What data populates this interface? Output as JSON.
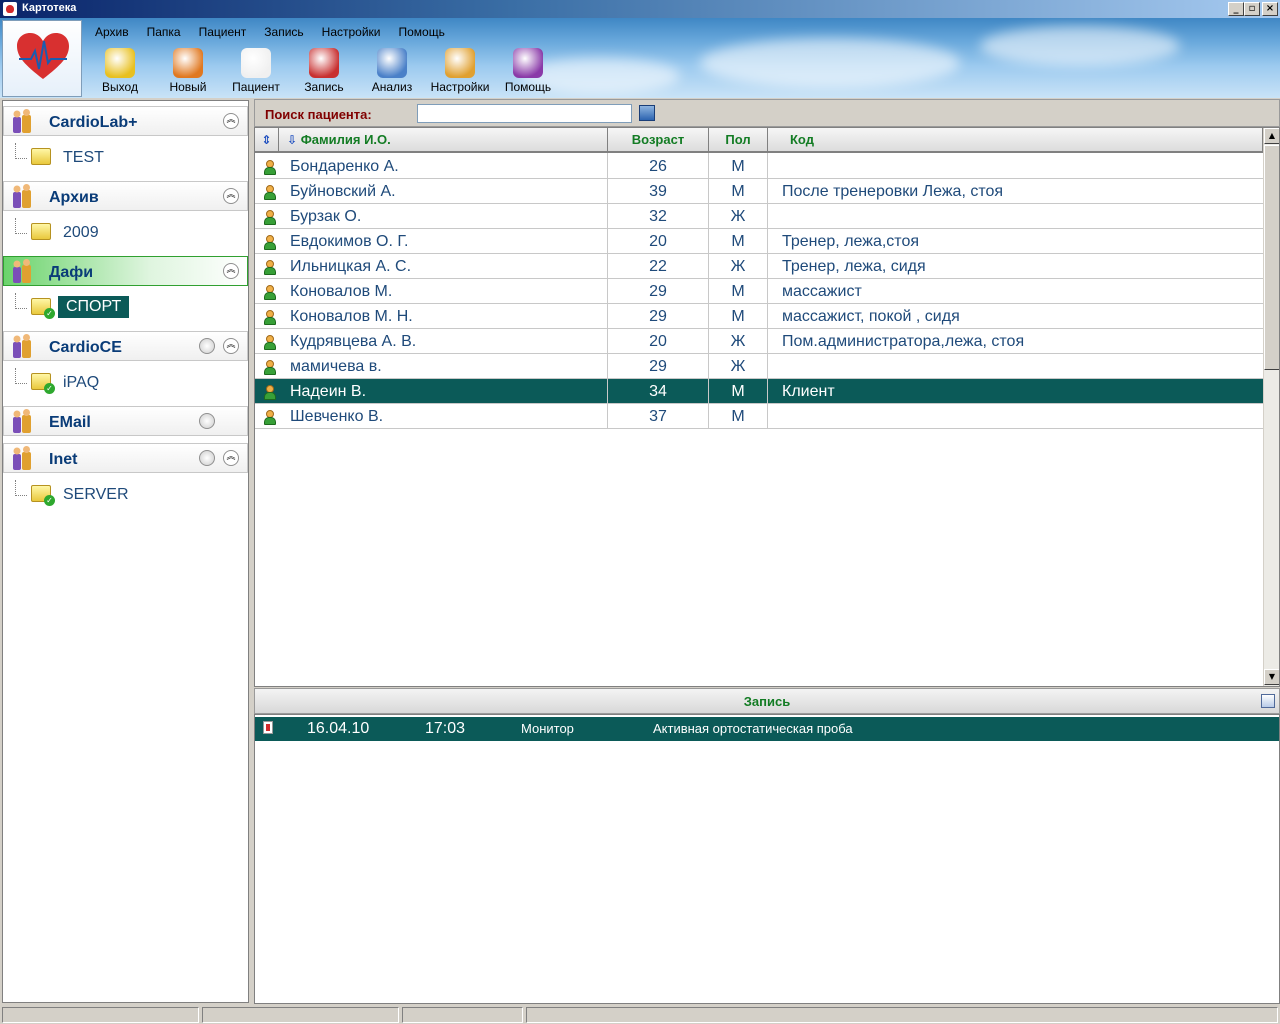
{
  "window": {
    "title": "Картотека"
  },
  "menu": [
    "Архив",
    "Папка",
    "Пациент",
    "Запись",
    "Настройки",
    "Помощь"
  ],
  "toolbar": [
    {
      "label": "Выход",
      "icon": "footprints-icon",
      "color": "#e8c020"
    },
    {
      "label": "Новый",
      "icon": "add-user-icon",
      "color": "#e07820"
    },
    {
      "label": "Пациент",
      "icon": "patient-card-icon",
      "color": "#f0f0f0"
    },
    {
      "label": "Запись",
      "icon": "record-icon",
      "color": "#c83030"
    },
    {
      "label": "Анализ",
      "icon": "analysis-computer-icon",
      "color": "#4a80c8"
    },
    {
      "label": "Настройки",
      "icon": "settings-checklist-icon",
      "color": "#e0a030"
    },
    {
      "label": "Помощь",
      "icon": "help-book-icon",
      "color": "#8a3aa8"
    }
  ],
  "sidebar": {
    "groups": [
      {
        "label": "CardioLab+",
        "icon": "people-group-icon",
        "sub": "TEST",
        "active": false,
        "has_status": false,
        "has_collapse": true
      },
      {
        "label": "Архив",
        "icon": "people-group-icon",
        "sub": "2009",
        "active": false,
        "has_status": false,
        "has_collapse": true
      },
      {
        "label": "Дафи",
        "icon": "people-group-icon",
        "sub": "СПОРТ",
        "active": true,
        "has_status": false,
        "has_collapse": true
      },
      {
        "label": "CardioCE",
        "icon": "pda-device-icon",
        "sub": "iPAQ",
        "active": false,
        "has_status": true,
        "has_collapse": true
      },
      {
        "label": "EMail",
        "icon": "email-folder-icon",
        "sub": "",
        "active": false,
        "has_status": true,
        "has_collapse": false
      },
      {
        "label": "Inet",
        "icon": "network-icon",
        "sub": "SERVER",
        "active": false,
        "has_status": true,
        "has_collapse": true
      }
    ]
  },
  "search": {
    "label": "Поиск пациента:",
    "value": ""
  },
  "patients": {
    "columns": {
      "name": "Фамилия И.О.",
      "age": "Возраст",
      "sex": "Пол",
      "code": "Код"
    },
    "rows": [
      {
        "name": "Бондаренко  А.",
        "age": "26",
        "sex": "М",
        "code": "",
        "selected": false
      },
      {
        "name": "Буйновский  А.",
        "age": "39",
        "sex": "М",
        "code": "После тренеровки Лежа, стоя",
        "selected": false
      },
      {
        "name": "Бурзак  О.",
        "age": "32",
        "sex": "Ж",
        "code": "",
        "selected": false
      },
      {
        "name": "Евдокимов  О. Г.",
        "age": "20",
        "sex": "М",
        "code": "Тренер, лежа,стоя",
        "selected": false
      },
      {
        "name": "Ильницкая  А. С.",
        "age": "22",
        "sex": "Ж",
        "code": "Тренер, лежа, сидя",
        "selected": false
      },
      {
        "name": "Коновалов  М.",
        "age": "29",
        "sex": "М",
        "code": "массажист",
        "selected": false
      },
      {
        "name": "Коновалов  М. Н.",
        "age": "29",
        "sex": "М",
        "code": "массажист, покой , сидя",
        "selected": false
      },
      {
        "name": "Кудрявцева  А. В.",
        "age": "20",
        "sex": "Ж",
        "code": "Пом.администратора,лежа, стоя",
        "selected": false
      },
      {
        "name": "мамичева  в.",
        "age": "29",
        "sex": "Ж",
        "code": "",
        "selected": false
      },
      {
        "name": "Надеин  В.",
        "age": "34",
        "sex": "М",
        "code": "Клиент",
        "selected": true
      },
      {
        "name": "Шевченко  В.",
        "age": "37",
        "sex": "М",
        "code": "",
        "selected": false
      }
    ]
  },
  "records": {
    "title": "Запись",
    "rows": [
      {
        "date": "16.04.10",
        "time": "17:03",
        "device": "Монитор",
        "description": "Активная ортостатическая проба"
      }
    ]
  },
  "colors": {
    "selection": "#0b5a58",
    "header_text": "#137c24",
    "search_label": "#800000",
    "text": "#1f4a7a"
  }
}
